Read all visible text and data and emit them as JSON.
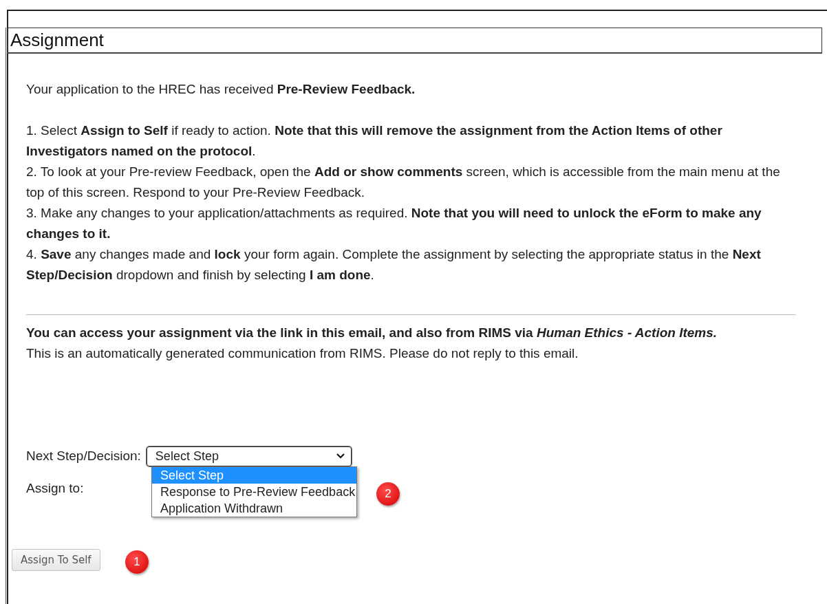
{
  "heading": "Assignment",
  "intro": "Your application to the HREC has received **Pre-Review Feedback.**",
  "steps": [
    "1. Select **Assign to Self** if ready to action. **Note that this will remove the assignment from the Action Items of other Investigators named on the protocol**.",
    "2. To look at your Pre-review Feedback, open the **Add or show comments** screen, which is accessible from the main menu at the top of this screen. Respond to your Pre-Review Feedback.",
    "3. Make any changes to your application/attachments as required. **Note that you will need to unlock the eForm to make any changes to it.**",
    "4. **Save** any changes made and **lock** your form again. Complete the assignment by selecting the appropriate status in the **Next Step/Decision** dropdown and finish by selecting **I am done**."
  ],
  "access_note": "You can access your assignment via the link in this email, and also from RIMS via *Human Ethics - Action Items.*",
  "auto_note": "This is an automatically generated communication from RIMS.  Please do not reply to this email.",
  "next_step": {
    "label": "Next Step/Decision:",
    "value": "Select Step",
    "expanded": true,
    "options": [
      {
        "label": "Select Step",
        "selected": true
      },
      {
        "label": "Response to Pre-Review Feedback",
        "selected": false
      },
      {
        "label": "Application Withdrawn",
        "selected": false
      }
    ],
    "badge": "2"
  },
  "assign_to": {
    "label": "Assign to:"
  },
  "assign_button": {
    "label": "Assign To Self",
    "badge": "1"
  }
}
